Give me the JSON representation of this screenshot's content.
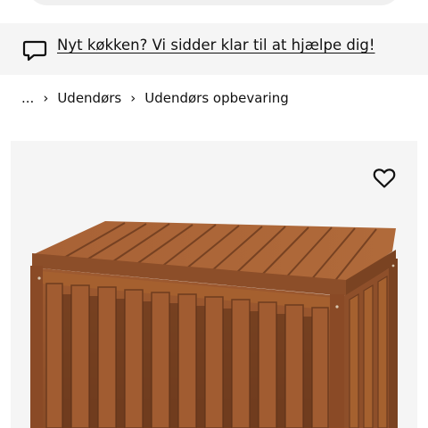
{
  "help_banner": {
    "icon": "chat-bubble-icon",
    "link_text": "Nyt køkken? Vi sidder klar til at hjælpe dig!"
  },
  "breadcrumb": {
    "items": [
      {
        "label": "..."
      },
      {
        "label": "Udendørs"
      },
      {
        "label": "Udendørs opbevaring"
      }
    ],
    "separator": "›"
  },
  "product": {
    "image_icon": "wooden-storage-box-image",
    "favorite_icon": "heart-icon"
  },
  "colors": {
    "banner_bg": "#f5f5f5",
    "image_bg": "#f5f5f5",
    "wood_main": "#9a5a32",
    "wood_dark": "#6e3c1f",
    "wood_light": "#b87446"
  }
}
